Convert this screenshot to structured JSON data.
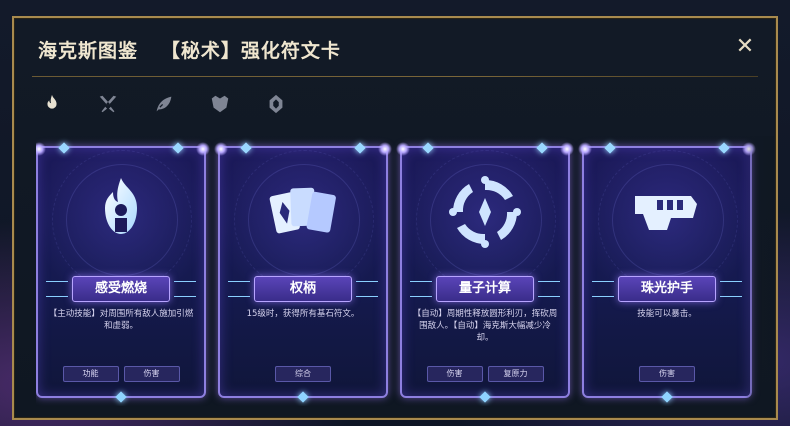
{
  "header": {
    "title": "海克斯图鉴   【秘术】强化符文卡",
    "close_icon": "close-icon"
  },
  "tabs": [
    {
      "icon": "flame-icon",
      "active": true
    },
    {
      "icon": "crossed-blades-icon",
      "active": false
    },
    {
      "icon": "leaf-icon",
      "active": false
    },
    {
      "icon": "shield-crest-icon",
      "active": false
    },
    {
      "icon": "hex-rune-icon",
      "active": false
    }
  ],
  "cards": [
    {
      "name": "感受燃烧",
      "icon": "burning-figure-icon",
      "description": "【主动技能】对周围所有敌人施加引燃和虚弱。",
      "tags": [
        "功能",
        "伤害"
      ]
    },
    {
      "name": "权柄",
      "icon": "rune-cards-icon",
      "description": "15级时，获得所有基石符文。",
      "tags": [
        "综合"
      ]
    },
    {
      "name": "量子计算",
      "icon": "quantum-ring-icon",
      "description": "【自动】周期性释放圆形利刃，挥砍周围敌人。【自动】海克斯大幅减少冷却。",
      "tags": [
        "伤害",
        "复原力"
      ]
    },
    {
      "name": "珠光护手",
      "icon": "gauntlet-icon",
      "description": "技能可以暴击。",
      "tags": [
        "伤害"
      ]
    }
  ],
  "colors": {
    "frame_gold": "#a88a4e",
    "card_border": "#8e7fe0",
    "card_bg": "#1c1a5a",
    "title_text": "#efe6cf"
  }
}
